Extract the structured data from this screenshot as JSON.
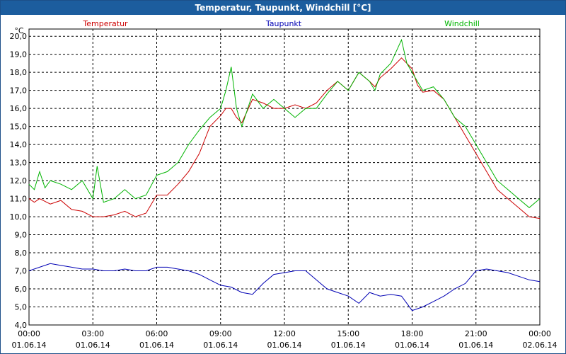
{
  "window": {
    "title": "Temperatur, Taupunkt, Windchill [°C]"
  },
  "chart_data": {
    "type": "line",
    "y_unit": "°C",
    "ylim": [
      4,
      20.4
    ],
    "y_ticks": [
      "4,0",
      "5,0",
      "6,0",
      "7,0",
      "8,0",
      "9,0",
      "10,0",
      "11,0",
      "12,0",
      "13,0",
      "14,0",
      "15,0",
      "16,0",
      "17,0",
      "18,0",
      "19,0",
      "20,0"
    ],
    "x_ticks": [
      {
        "time": "00:00",
        "date": "01.06.14"
      },
      {
        "time": "03:00",
        "date": "01.06.14"
      },
      {
        "time": "06:00",
        "date": "01.06.14"
      },
      {
        "time": "09:00",
        "date": "01.06.14"
      },
      {
        "time": "12:00",
        "date": "01.06.14"
      },
      {
        "time": "15:00",
        "date": "01.06.14"
      },
      {
        "time": "18:00",
        "date": "01.06.14"
      },
      {
        "time": "21:00",
        "date": "01.06.14"
      },
      {
        "time": "00:00",
        "date": "02.06.14"
      }
    ],
    "grid": true,
    "series": [
      {
        "name": "Temperatur",
        "color": "#cc0000",
        "points": [
          [
            0,
            11.0
          ],
          [
            0.25,
            10.8
          ],
          [
            0.5,
            11.0
          ],
          [
            1,
            10.7
          ],
          [
            1.5,
            10.9
          ],
          [
            2,
            10.4
          ],
          [
            2.5,
            10.3
          ],
          [
            3,
            10.0
          ],
          [
            3.5,
            10.0
          ],
          [
            4,
            10.1
          ],
          [
            4.5,
            10.3
          ],
          [
            5,
            10.0
          ],
          [
            5.5,
            10.2
          ],
          [
            6,
            11.2
          ],
          [
            6.5,
            11.2
          ],
          [
            7,
            11.8
          ],
          [
            7.5,
            12.5
          ],
          [
            8,
            13.5
          ],
          [
            8.5,
            15.0
          ],
          [
            9,
            15.6
          ],
          [
            9.25,
            16.0
          ],
          [
            9.5,
            16.0
          ],
          [
            9.75,
            15.5
          ],
          [
            10,
            15.2
          ],
          [
            10.5,
            16.5
          ],
          [
            11,
            16.3
          ],
          [
            11.5,
            16.0
          ],
          [
            12,
            16.0
          ],
          [
            12.5,
            16.2
          ],
          [
            13,
            16.0
          ],
          [
            13.5,
            16.3
          ],
          [
            14,
            17.0
          ],
          [
            14.5,
            17.5
          ],
          [
            15,
            17.0
          ],
          [
            15.5,
            18.0
          ],
          [
            16,
            17.5
          ],
          [
            16.25,
            17.2
          ],
          [
            16.5,
            17.7
          ],
          [
            17,
            18.2
          ],
          [
            17.5,
            18.8
          ],
          [
            18,
            18.2
          ],
          [
            18.25,
            17.3
          ],
          [
            18.5,
            16.9
          ],
          [
            19,
            17.0
          ],
          [
            19.5,
            16.5
          ],
          [
            20,
            15.5
          ],
          [
            20.5,
            14.5
          ],
          [
            21,
            13.5
          ],
          [
            21.5,
            12.5
          ],
          [
            22,
            11.5
          ],
          [
            22.5,
            11.0
          ],
          [
            23,
            10.5
          ],
          [
            23.5,
            10.0
          ],
          [
            24,
            9.9
          ]
        ]
      },
      {
        "name": "Taupunkt",
        "color": "#0000b4",
        "points": [
          [
            0,
            7.0
          ],
          [
            0.5,
            7.2
          ],
          [
            1,
            7.4
          ],
          [
            1.5,
            7.3
          ],
          [
            2,
            7.2
          ],
          [
            2.5,
            7.1
          ],
          [
            3,
            7.1
          ],
          [
            3.5,
            7.0
          ],
          [
            4,
            7.0
          ],
          [
            4.5,
            7.1
          ],
          [
            5,
            7.0
          ],
          [
            5.5,
            7.0
          ],
          [
            6,
            7.2
          ],
          [
            6.5,
            7.2
          ],
          [
            7,
            7.1
          ],
          [
            7.5,
            7.0
          ],
          [
            8,
            6.8
          ],
          [
            8.5,
            6.5
          ],
          [
            9,
            6.2
          ],
          [
            9.5,
            6.1
          ],
          [
            10,
            5.8
          ],
          [
            10.5,
            5.7
          ],
          [
            11,
            6.3
          ],
          [
            11.5,
            6.8
          ],
          [
            12,
            6.9
          ],
          [
            12.5,
            7.0
          ],
          [
            13,
            7.0
          ],
          [
            13.5,
            6.5
          ],
          [
            14,
            6.0
          ],
          [
            14.5,
            5.8
          ],
          [
            15,
            5.6
          ],
          [
            15.5,
            5.2
          ],
          [
            16,
            5.8
          ],
          [
            16.5,
            5.6
          ],
          [
            17,
            5.7
          ],
          [
            17.5,
            5.6
          ],
          [
            18,
            4.8
          ],
          [
            18.5,
            5.0
          ],
          [
            19,
            5.3
          ],
          [
            19.5,
            5.6
          ],
          [
            20,
            6.0
          ],
          [
            20.5,
            6.3
          ],
          [
            21,
            7.0
          ],
          [
            21.5,
            7.1
          ],
          [
            22,
            7.0
          ],
          [
            22.5,
            6.9
          ],
          [
            23,
            6.7
          ],
          [
            23.5,
            6.5
          ],
          [
            24,
            6.4
          ]
        ]
      },
      {
        "name": "Windchill",
        "color": "#00b400",
        "points": [
          [
            0,
            11.8
          ],
          [
            0.25,
            11.5
          ],
          [
            0.5,
            12.5
          ],
          [
            0.75,
            11.6
          ],
          [
            1,
            12.0
          ],
          [
            1.5,
            11.8
          ],
          [
            2,
            11.5
          ],
          [
            2.5,
            12.0
          ],
          [
            3,
            11.0
          ],
          [
            3.2,
            12.8
          ],
          [
            3.5,
            10.8
          ],
          [
            4,
            11.0
          ],
          [
            4.5,
            11.5
          ],
          [
            5,
            11.0
          ],
          [
            5.5,
            11.2
          ],
          [
            6,
            12.3
          ],
          [
            6.5,
            12.5
          ],
          [
            7,
            13.0
          ],
          [
            7.5,
            14.0
          ],
          [
            8,
            14.8
          ],
          [
            8.5,
            15.5
          ],
          [
            9,
            16.0
          ],
          [
            9.25,
            17.0
          ],
          [
            9.5,
            18.3
          ],
          [
            9.75,
            16.0
          ],
          [
            10,
            15.0
          ],
          [
            10.5,
            16.8
          ],
          [
            11,
            16.0
          ],
          [
            11.5,
            16.5
          ],
          [
            12,
            16.0
          ],
          [
            12.5,
            15.5
          ],
          [
            13,
            16.0
          ],
          [
            13.5,
            16.0
          ],
          [
            14,
            16.8
          ],
          [
            14.5,
            17.5
          ],
          [
            15,
            17.0
          ],
          [
            15.5,
            18.0
          ],
          [
            16,
            17.5
          ],
          [
            16.25,
            17.0
          ],
          [
            16.5,
            17.9
          ],
          [
            17,
            18.5
          ],
          [
            17.5,
            19.8
          ],
          [
            17.75,
            18.5
          ],
          [
            18,
            18.0
          ],
          [
            18.5,
            17.0
          ],
          [
            19,
            17.2
          ],
          [
            19.5,
            16.5
          ],
          [
            20,
            15.5
          ],
          [
            20.5,
            15.0
          ],
          [
            21,
            14.0
          ],
          [
            21.5,
            13.0
          ],
          [
            22,
            12.0
          ],
          [
            22.5,
            11.5
          ],
          [
            23,
            11.0
          ],
          [
            23.5,
            10.5
          ],
          [
            24,
            11.0
          ]
        ]
      }
    ]
  }
}
